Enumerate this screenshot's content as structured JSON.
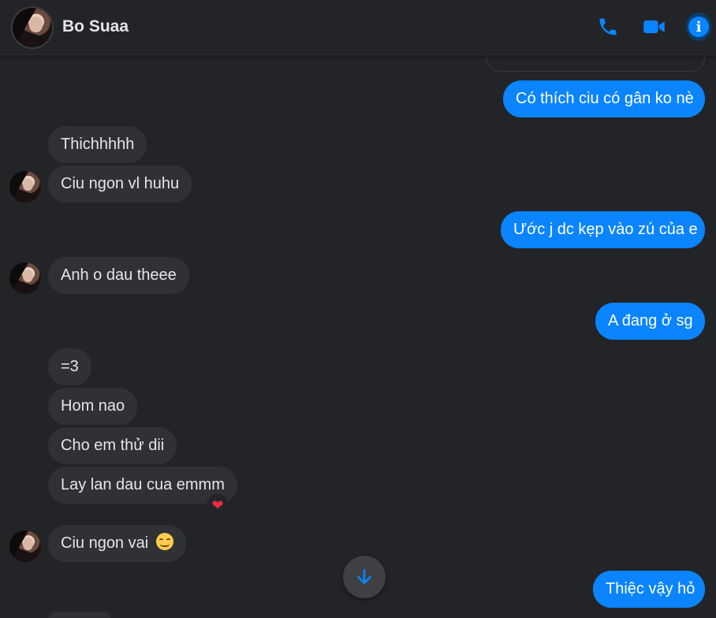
{
  "header": {
    "contact_name": "Bo Suaa",
    "icons": [
      "phone-icon",
      "video-camera-icon",
      "info-icon"
    ],
    "accent_color": "#0a84ff"
  },
  "messages": [
    {
      "side": "out",
      "text": "Có thích ciu có gân ko nè"
    },
    {
      "side": "in",
      "text": "Thichhhhh"
    },
    {
      "side": "in",
      "text": "Ciu ngon vl huhu"
    },
    {
      "side": "out",
      "text": "Ước j dc kẹp vào zú của e"
    },
    {
      "side": "in",
      "text": "Anh o dau theee"
    },
    {
      "side": "out",
      "text": "A đang ở sg"
    },
    {
      "side": "in",
      "text": "=3"
    },
    {
      "side": "in",
      "text": "Hom nao"
    },
    {
      "side": "in",
      "text": "Cho em thử dii"
    },
    {
      "side": "in",
      "text": "Lay lan dau cua emmm",
      "reaction": "❤"
    },
    {
      "side": "in",
      "text": "Ciu ngon vai",
      "emoji": "smiling-face-icon"
    },
    {
      "side": "out",
      "text": "Thiệc vậy hỏ"
    }
  ],
  "colors": {
    "background": "#232427",
    "incoming_bubble": "#303134",
    "outgoing_bubble": "#0a84ff",
    "reaction_heart": "#f02849"
  }
}
